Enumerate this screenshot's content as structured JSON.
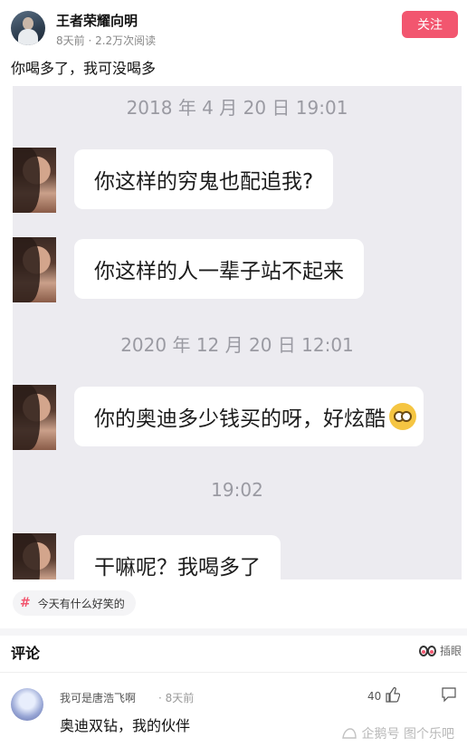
{
  "post": {
    "author": "王者荣耀向明",
    "meta": "8天前 · 2.2万次阅读",
    "follow_label": "关注",
    "title": "你喝多了，我可没喝多"
  },
  "chat": {
    "timestamp_1": "2018 年 4 月 20 日 19:01",
    "msg_1": "你这样的穷鬼也配追我?",
    "msg_2": "你这样的人一辈子站不起来",
    "timestamp_2": "2020 年 12 月 20 日 12:01",
    "msg_3": "你的奥迪多少钱买的呀，好炫酷",
    "timestamp_3": "19:02",
    "msg_4": "干嘛呢？我喝多了"
  },
  "topic": {
    "label": "今天有什么好笑的"
  },
  "comments": {
    "title": "评论",
    "insert_label": "插眼",
    "items": [
      {
        "author": "我可是唐浩飞啊",
        "time": "· 8天前",
        "likes": "40",
        "text": "奥迪双钻，我的伙伴"
      }
    ]
  },
  "watermark": "企鹅号 图个乐吧",
  "icons": [
    "avatar",
    "hash-icon",
    "eyes-icon",
    "thumbs-up-icon",
    "share-icon",
    "penguin-icon",
    "emoji-icon"
  ]
}
